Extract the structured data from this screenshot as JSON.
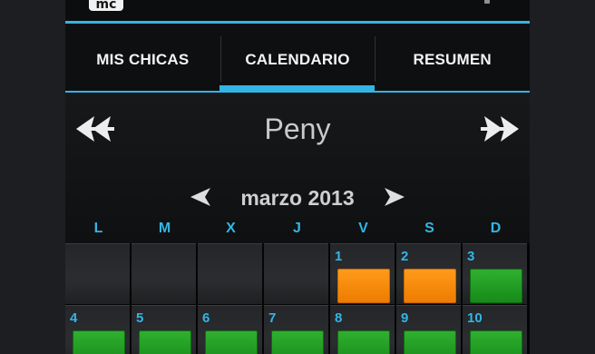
{
  "actionbar": {
    "icon_text": "mc"
  },
  "tabs": [
    {
      "label": "MIS CHICAS",
      "selected": false
    },
    {
      "label": "CALENDARIO",
      "selected": true
    },
    {
      "label": "RESUMEN",
      "selected": false
    }
  ],
  "header": {
    "girl_name": "Peny",
    "month": "marzo 2013"
  },
  "weekdays": [
    "L",
    "M",
    "X",
    "J",
    "V",
    "S",
    "D"
  ],
  "calendar": {
    "week1": [
      {
        "day": "",
        "marker": "none"
      },
      {
        "day": "",
        "marker": "none"
      },
      {
        "day": "",
        "marker": "none"
      },
      {
        "day": "",
        "marker": "none"
      },
      {
        "day": "1",
        "marker": "orange"
      },
      {
        "day": "2",
        "marker": "orange"
      },
      {
        "day": "3",
        "marker": "green"
      }
    ],
    "week2": [
      {
        "day": "4",
        "marker": "green"
      },
      {
        "day": "5",
        "marker": "green"
      },
      {
        "day": "6",
        "marker": "green"
      },
      {
        "day": "7",
        "marker": "green"
      },
      {
        "day": "8",
        "marker": "green"
      },
      {
        "day": "9",
        "marker": "green"
      },
      {
        "day": "10",
        "marker": "green"
      }
    ]
  },
  "colors": {
    "accent": "#33b5e5",
    "marker_orange": "#f5870a",
    "marker_green": "#1f9a22"
  }
}
